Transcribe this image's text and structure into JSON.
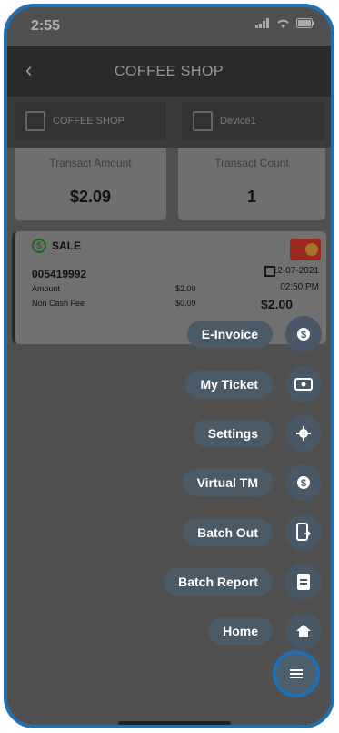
{
  "status_bar": {
    "time": "2:55"
  },
  "header": {
    "title": "COFFEE SHOP",
    "back_icon": "chevron-left-icon"
  },
  "selectors": [
    {
      "label": "COFFEE SHOP",
      "icon": "store-icon"
    },
    {
      "label": "Device1",
      "icon": "device-icon"
    }
  ],
  "summary": [
    {
      "label": "Transact Amount",
      "value": "$2.09"
    },
    {
      "label": "Transact Count",
      "value": "1"
    }
  ],
  "transaction": {
    "type": "SALE",
    "id": "005419992",
    "date": "12-07-2021",
    "time": "02:50 PM",
    "rows": [
      {
        "label": "Amount",
        "value": "$2.00"
      },
      {
        "label": "Non Cash Fee",
        "value": "$0.09"
      }
    ],
    "total": "$2.00",
    "card_brand_icon": "mastercard-icon"
  },
  "menu": [
    {
      "label": "E-Invoice",
      "icon": "dollar-circle-icon"
    },
    {
      "label": "My Ticket",
      "icon": "ticket-icon"
    },
    {
      "label": "Settings",
      "icon": "gear-icon"
    },
    {
      "label": "Virtual TM",
      "icon": "dollar-circle-icon"
    },
    {
      "label": "Batch Out",
      "icon": "phone-transfer-icon"
    },
    {
      "label": "Batch Report",
      "icon": "report-icon"
    },
    {
      "label": "Home",
      "icon": "home-icon"
    }
  ],
  "menu_toggle_icon": "hamburger-menu-icon",
  "colors": {
    "fab": "#485866",
    "highlight": "#1f6fb5"
  }
}
